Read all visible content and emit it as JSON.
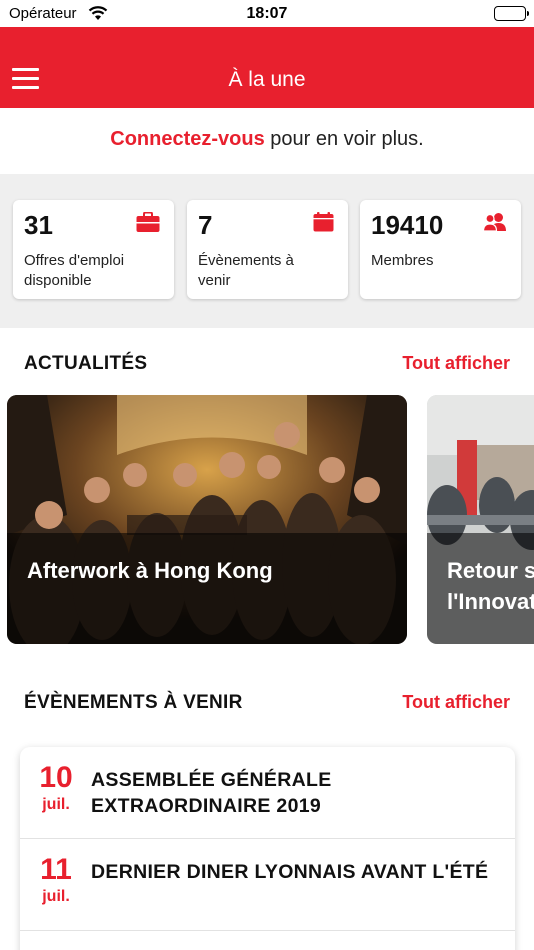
{
  "status_bar": {
    "carrier": "Opérateur",
    "time": "18:07"
  },
  "nav": {
    "title": "À la une",
    "menu_icon": "hamburger-menu-icon"
  },
  "login_prompt": {
    "link": "Connectez-vous",
    "text": " pour en voir plus."
  },
  "stats": [
    {
      "value": "31",
      "label": "Offres d'emploi disponible",
      "icon": "briefcase-icon"
    },
    {
      "value": "7",
      "label": "Évènements à venir",
      "icon": "calendar-icon"
    },
    {
      "value": "19410",
      "label": "Membres",
      "icon": "users-icon"
    }
  ],
  "news": {
    "title": "ACTUALITÉS",
    "see_all": "Tout afficher",
    "items": [
      {
        "caption": "Afterwork à Hong Kong"
      },
      {
        "caption": "Retour sur l'Innovation"
      }
    ]
  },
  "events": {
    "title": "ÉVÈNEMENTS À VENIR",
    "see_all": "Tout afficher",
    "items": [
      {
        "day": "10",
        "month": "juil.",
        "title": "ASSEMBLÉE GÉNÉRALE EXTRAORDINAIRE 2019"
      },
      {
        "day": "11",
        "month": "juil.",
        "title": "DERNIER DINER LYONNAIS AVANT L'ÉTÉ"
      }
    ]
  },
  "colors": {
    "accent": "#e8202e",
    "background": "#efefef"
  }
}
